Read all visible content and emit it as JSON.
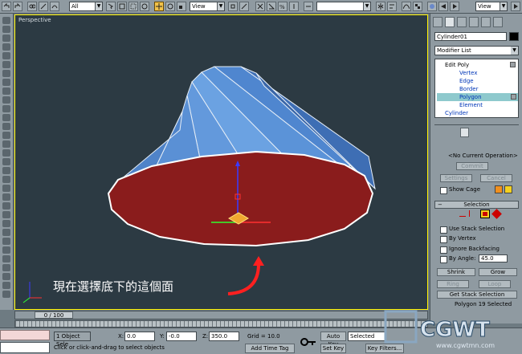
{
  "toolbar": {
    "selection_filter": "All",
    "ref_coord_1": "View",
    "ref_coord_2": "View",
    "named_selection": ""
  },
  "viewport": {
    "label": "Perspective",
    "annotation": "現在選擇底下的這個面"
  },
  "command_panel": {
    "object_name": "Cylinder01",
    "modifier_list": "Modifier List",
    "stack": [
      {
        "label": "Edit Poly"
      },
      {
        "label": "Vertex"
      },
      {
        "label": "Edge"
      },
      {
        "label": "Border"
      },
      {
        "label": "Polygon"
      },
      {
        "label": "Element"
      },
      {
        "label": "Cylinder"
      }
    ],
    "operation": {
      "status": "<No Current Operation>",
      "commit": "Commit",
      "settings": "Settings",
      "cancel": "Cancel",
      "show_cage": "Show Cage"
    },
    "selection": {
      "title": "Selection",
      "use_stack": "Use Stack Selection",
      "by_vertex": "By Vertex",
      "ignore_backfacing": "Ignore Backfacing",
      "by_angle": "By Angle:",
      "angle_value": "45.0",
      "shrink": "Shrink",
      "grow": "Grow",
      "ring": "Ring",
      "loop": "Loop",
      "get_stack": "Get Stack Selection",
      "info": "Polygon 19 Selected"
    }
  },
  "timeline": {
    "frame": "0 / 100"
  },
  "status": {
    "selected_count": "1 Object Sele",
    "x_label": "X:",
    "x_value": "0.0",
    "y_label": "Y:",
    "y_value": "-0.0",
    "z_label": "Z:",
    "z_value": "350.0",
    "grid": "Grid = 10.0",
    "prompt": "Click or click-and-drag to select objects",
    "add_time_tag": "Add Time Tag",
    "auto_key": "Auto Key",
    "set_key": "Set Key",
    "key_mode": "Selected",
    "key_filters": "Key Filters..."
  },
  "watermark": {
    "brand": "CGWT",
    "url": "www.cgwtmn.com"
  },
  "colors": {
    "viewport_bg": "#2c3a43",
    "cone_side": "#4f86d0",
    "selected_face": "#8a1c1c",
    "annotation": "#ffffff",
    "highlight": "#8ec9cd",
    "active_border": "#fff200"
  }
}
